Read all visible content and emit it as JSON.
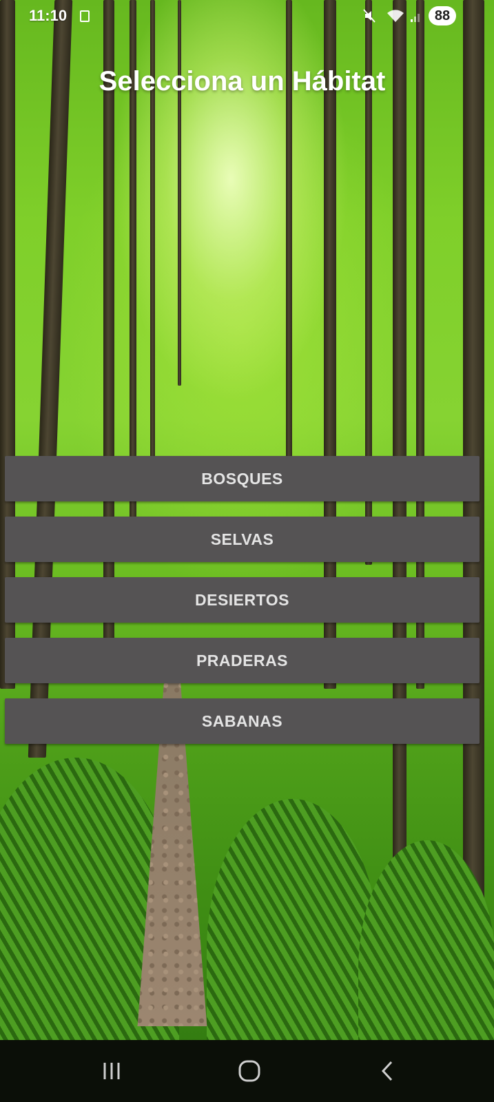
{
  "status_bar": {
    "time": "11:10",
    "battery": "88"
  },
  "title": "Selecciona un Hábitat",
  "habitats": [
    "BOSQUES",
    "SELVAS",
    "DESIERTOS",
    "PRADERAS",
    "SABANAS"
  ],
  "icons": {
    "sim": "sim-card-icon",
    "mute": "mute-icon",
    "wifi": "wifi-icon",
    "signal": "signal-icon",
    "recents": "recents-icon",
    "home": "home-icon",
    "back": "back-icon"
  },
  "colors": {
    "button_bg": "#555354",
    "button_text": "#e4e4e4",
    "title_text": "#ffffff",
    "nav_bar": "#0b0f08"
  }
}
